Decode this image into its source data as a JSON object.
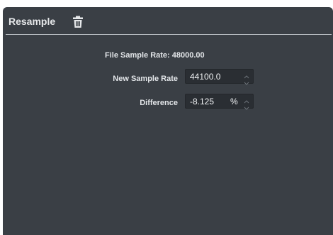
{
  "panel": {
    "title": "Resample",
    "delete_icon": "trash-icon"
  },
  "info": {
    "file_sample_rate": "File Sample Rate: 48000.00"
  },
  "new_sample_rate": {
    "label": "New Sample Rate",
    "value": "44100.0"
  },
  "difference": {
    "label": "Difference",
    "value": "-8.125",
    "unit": "%"
  },
  "colors": {
    "panel_bg": "#3a3f45",
    "field_bg": "#2a2e33",
    "text": "#e3e6e9"
  }
}
